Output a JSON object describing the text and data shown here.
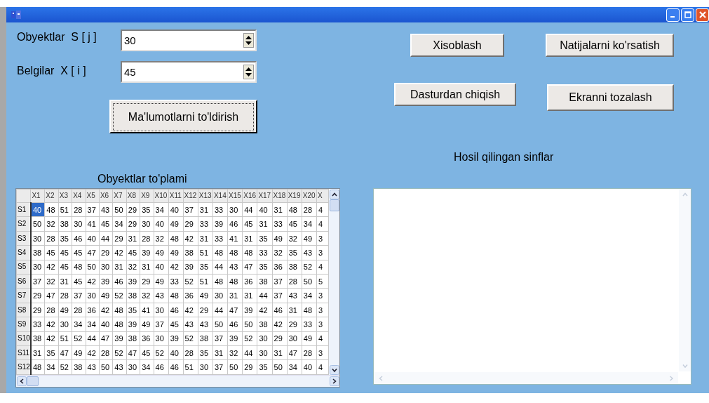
{
  "fields": [
    {
      "label": "Obyektlar  S [ j ]",
      "value": "30"
    },
    {
      "label": "Belgilar  X [ i ]",
      "value": "45"
    }
  ],
  "fill_button": {
    "label": "Ma'lumotlarni to'ldirish",
    "focused": true
  },
  "buttons": [
    {
      "label": "Xisoblash"
    },
    {
      "label": "Natijalarni ko'rsatish"
    },
    {
      "label": "Dasturdan chiqish"
    },
    {
      "label": "Ekranni tozalash"
    }
  ],
  "table": {
    "title": "Obyektlar to'plami",
    "columns": [
      "X1",
      "X2",
      "X3",
      "X4",
      "X5",
      "X6",
      "X7",
      "X8",
      "X9",
      "X10",
      "X11",
      "X12",
      "X13",
      "X14",
      "X15",
      "X16",
      "X17",
      "X18",
      "X19",
      "X20",
      "X"
    ],
    "rows": [
      {
        "header": "S1",
        "cells": [
          {
            "text": "40",
            "selected": true
          },
          {
            "text": "48",
            "selected": false
          },
          {
            "text": "51",
            "selected": false
          },
          {
            "text": "28",
            "selected": false
          },
          {
            "text": "37",
            "selected": false
          },
          {
            "text": "43",
            "selected": false
          },
          {
            "text": "50",
            "selected": false
          },
          {
            "text": "29",
            "selected": false
          },
          {
            "text": "35",
            "selected": false
          },
          {
            "text": "34",
            "selected": false
          },
          {
            "text": "40",
            "selected": false
          },
          {
            "text": "37",
            "selected": false
          },
          {
            "text": "31",
            "selected": false
          },
          {
            "text": "33",
            "selected": false
          },
          {
            "text": "30",
            "selected": false
          },
          {
            "text": "44",
            "selected": false
          },
          {
            "text": "40",
            "selected": false
          },
          {
            "text": "31",
            "selected": false
          },
          {
            "text": "48",
            "selected": false
          },
          {
            "text": "28",
            "selected": false
          },
          {
            "text": "4",
            "selected": false
          }
        ]
      },
      {
        "header": "S2",
        "cells": [
          {
            "text": "50",
            "selected": false
          },
          {
            "text": "32",
            "selected": false
          },
          {
            "text": "38",
            "selected": false
          },
          {
            "text": "30",
            "selected": false
          },
          {
            "text": "41",
            "selected": false
          },
          {
            "text": "45",
            "selected": false
          },
          {
            "text": "34",
            "selected": false
          },
          {
            "text": "29",
            "selected": false
          },
          {
            "text": "30",
            "selected": false
          },
          {
            "text": "40",
            "selected": false
          },
          {
            "text": "49",
            "selected": false
          },
          {
            "text": "29",
            "selected": false
          },
          {
            "text": "33",
            "selected": false
          },
          {
            "text": "39",
            "selected": false
          },
          {
            "text": "46",
            "selected": false
          },
          {
            "text": "45",
            "selected": false
          },
          {
            "text": "31",
            "selected": false
          },
          {
            "text": "33",
            "selected": false
          },
          {
            "text": "45",
            "selected": false
          },
          {
            "text": "34",
            "selected": false
          },
          {
            "text": "4",
            "selected": false
          }
        ]
      },
      {
        "header": "S3",
        "cells": [
          {
            "text": "30",
            "selected": false
          },
          {
            "text": "28",
            "selected": false
          },
          {
            "text": "35",
            "selected": false
          },
          {
            "text": "46",
            "selected": false
          },
          {
            "text": "40",
            "selected": false
          },
          {
            "text": "44",
            "selected": false
          },
          {
            "text": "29",
            "selected": false
          },
          {
            "text": "31",
            "selected": false
          },
          {
            "text": "28",
            "selected": false
          },
          {
            "text": "32",
            "selected": false
          },
          {
            "text": "48",
            "selected": false
          },
          {
            "text": "42",
            "selected": false
          },
          {
            "text": "31",
            "selected": false
          },
          {
            "text": "33",
            "selected": false
          },
          {
            "text": "41",
            "selected": false
          },
          {
            "text": "31",
            "selected": false
          },
          {
            "text": "35",
            "selected": false
          },
          {
            "text": "49",
            "selected": false
          },
          {
            "text": "32",
            "selected": false
          },
          {
            "text": "49",
            "selected": false
          },
          {
            "text": "3",
            "selected": false
          }
        ]
      },
      {
        "header": "S4",
        "cells": [
          {
            "text": "38",
            "selected": false
          },
          {
            "text": "45",
            "selected": false
          },
          {
            "text": "45",
            "selected": false
          },
          {
            "text": "45",
            "selected": false
          },
          {
            "text": "47",
            "selected": false
          },
          {
            "text": "29",
            "selected": false
          },
          {
            "text": "42",
            "selected": false
          },
          {
            "text": "45",
            "selected": false
          },
          {
            "text": "39",
            "selected": false
          },
          {
            "text": "49",
            "selected": false
          },
          {
            "text": "49",
            "selected": false
          },
          {
            "text": "38",
            "selected": false
          },
          {
            "text": "51",
            "selected": false
          },
          {
            "text": "48",
            "selected": false
          },
          {
            "text": "48",
            "selected": false
          },
          {
            "text": "48",
            "selected": false
          },
          {
            "text": "33",
            "selected": false
          },
          {
            "text": "32",
            "selected": false
          },
          {
            "text": "35",
            "selected": false
          },
          {
            "text": "43",
            "selected": false
          },
          {
            "text": "3",
            "selected": false
          }
        ]
      },
      {
        "header": "S5",
        "cells": [
          {
            "text": "30",
            "selected": false
          },
          {
            "text": "42",
            "selected": false
          },
          {
            "text": "45",
            "selected": false
          },
          {
            "text": "48",
            "selected": false
          },
          {
            "text": "50",
            "selected": false
          },
          {
            "text": "30",
            "selected": false
          },
          {
            "text": "31",
            "selected": false
          },
          {
            "text": "32",
            "selected": false
          },
          {
            "text": "31",
            "selected": false
          },
          {
            "text": "40",
            "selected": false
          },
          {
            "text": "42",
            "selected": false
          },
          {
            "text": "39",
            "selected": false
          },
          {
            "text": "35",
            "selected": false
          },
          {
            "text": "44",
            "selected": false
          },
          {
            "text": "43",
            "selected": false
          },
          {
            "text": "47",
            "selected": false
          },
          {
            "text": "35",
            "selected": false
          },
          {
            "text": "36",
            "selected": false
          },
          {
            "text": "38",
            "selected": false
          },
          {
            "text": "52",
            "selected": false
          },
          {
            "text": "4",
            "selected": false
          }
        ]
      },
      {
        "header": "S6",
        "cells": [
          {
            "text": "37",
            "selected": false
          },
          {
            "text": "32",
            "selected": false
          },
          {
            "text": "31",
            "selected": false
          },
          {
            "text": "45",
            "selected": false
          },
          {
            "text": "42",
            "selected": false
          },
          {
            "text": "39",
            "selected": false
          },
          {
            "text": "46",
            "selected": false
          },
          {
            "text": "39",
            "selected": false
          },
          {
            "text": "29",
            "selected": false
          },
          {
            "text": "49",
            "selected": false
          },
          {
            "text": "33",
            "selected": false
          },
          {
            "text": "52",
            "selected": false
          },
          {
            "text": "51",
            "selected": false
          },
          {
            "text": "48",
            "selected": false
          },
          {
            "text": "48",
            "selected": false
          },
          {
            "text": "36",
            "selected": false
          },
          {
            "text": "38",
            "selected": false
          },
          {
            "text": "37",
            "selected": false
          },
          {
            "text": "28",
            "selected": false
          },
          {
            "text": "50",
            "selected": false
          },
          {
            "text": "5",
            "selected": false
          }
        ]
      },
      {
        "header": "S7",
        "cells": [
          {
            "text": "29",
            "selected": false
          },
          {
            "text": "47",
            "selected": false
          },
          {
            "text": "28",
            "selected": false
          },
          {
            "text": "37",
            "selected": false
          },
          {
            "text": "30",
            "selected": false
          },
          {
            "text": "49",
            "selected": false
          },
          {
            "text": "52",
            "selected": false
          },
          {
            "text": "38",
            "selected": false
          },
          {
            "text": "32",
            "selected": false
          },
          {
            "text": "43",
            "selected": false
          },
          {
            "text": "48",
            "selected": false
          },
          {
            "text": "36",
            "selected": false
          },
          {
            "text": "49",
            "selected": false
          },
          {
            "text": "30",
            "selected": false
          },
          {
            "text": "31",
            "selected": false
          },
          {
            "text": "31",
            "selected": false
          },
          {
            "text": "44",
            "selected": false
          },
          {
            "text": "37",
            "selected": false
          },
          {
            "text": "43",
            "selected": false
          },
          {
            "text": "34",
            "selected": false
          },
          {
            "text": "3",
            "selected": false
          }
        ]
      },
      {
        "header": "S8",
        "cells": [
          {
            "text": "29",
            "selected": false
          },
          {
            "text": "28",
            "selected": false
          },
          {
            "text": "49",
            "selected": false
          },
          {
            "text": "28",
            "selected": false
          },
          {
            "text": "36",
            "selected": false
          },
          {
            "text": "42",
            "selected": false
          },
          {
            "text": "48",
            "selected": false
          },
          {
            "text": "35",
            "selected": false
          },
          {
            "text": "41",
            "selected": false
          },
          {
            "text": "30",
            "selected": false
          },
          {
            "text": "46",
            "selected": false
          },
          {
            "text": "42",
            "selected": false
          },
          {
            "text": "29",
            "selected": false
          },
          {
            "text": "44",
            "selected": false
          },
          {
            "text": "47",
            "selected": false
          },
          {
            "text": "39",
            "selected": false
          },
          {
            "text": "42",
            "selected": false
          },
          {
            "text": "46",
            "selected": false
          },
          {
            "text": "31",
            "selected": false
          },
          {
            "text": "48",
            "selected": false
          },
          {
            "text": "3",
            "selected": false
          }
        ]
      },
      {
        "header": "S9",
        "cells": [
          {
            "text": "33",
            "selected": false
          },
          {
            "text": "42",
            "selected": false
          },
          {
            "text": "30",
            "selected": false
          },
          {
            "text": "34",
            "selected": false
          },
          {
            "text": "34",
            "selected": false
          },
          {
            "text": "40",
            "selected": false
          },
          {
            "text": "48",
            "selected": false
          },
          {
            "text": "39",
            "selected": false
          },
          {
            "text": "49",
            "selected": false
          },
          {
            "text": "37",
            "selected": false
          },
          {
            "text": "45",
            "selected": false
          },
          {
            "text": "43",
            "selected": false
          },
          {
            "text": "43",
            "selected": false
          },
          {
            "text": "50",
            "selected": false
          },
          {
            "text": "46",
            "selected": false
          },
          {
            "text": "50",
            "selected": false
          },
          {
            "text": "38",
            "selected": false
          },
          {
            "text": "42",
            "selected": false
          },
          {
            "text": "29",
            "selected": false
          },
          {
            "text": "33",
            "selected": false
          },
          {
            "text": "3",
            "selected": false
          }
        ]
      },
      {
        "header": "S10",
        "cells": [
          {
            "text": "38",
            "selected": false
          },
          {
            "text": "42",
            "selected": false
          },
          {
            "text": "51",
            "selected": false
          },
          {
            "text": "52",
            "selected": false
          },
          {
            "text": "44",
            "selected": false
          },
          {
            "text": "47",
            "selected": false
          },
          {
            "text": "39",
            "selected": false
          },
          {
            "text": "38",
            "selected": false
          },
          {
            "text": "36",
            "selected": false
          },
          {
            "text": "30",
            "selected": false
          },
          {
            "text": "39",
            "selected": false
          },
          {
            "text": "52",
            "selected": false
          },
          {
            "text": "38",
            "selected": false
          },
          {
            "text": "37",
            "selected": false
          },
          {
            "text": "39",
            "selected": false
          },
          {
            "text": "52",
            "selected": false
          },
          {
            "text": "30",
            "selected": false
          },
          {
            "text": "29",
            "selected": false
          },
          {
            "text": "30",
            "selected": false
          },
          {
            "text": "49",
            "selected": false
          },
          {
            "text": "4",
            "selected": false
          }
        ]
      },
      {
        "header": "S11",
        "cells": [
          {
            "text": "31",
            "selected": false
          },
          {
            "text": "35",
            "selected": false
          },
          {
            "text": "47",
            "selected": false
          },
          {
            "text": "49",
            "selected": false
          },
          {
            "text": "42",
            "selected": false
          },
          {
            "text": "28",
            "selected": false
          },
          {
            "text": "52",
            "selected": false
          },
          {
            "text": "47",
            "selected": false
          },
          {
            "text": "45",
            "selected": false
          },
          {
            "text": "52",
            "selected": false
          },
          {
            "text": "40",
            "selected": false
          },
          {
            "text": "28",
            "selected": false
          },
          {
            "text": "35",
            "selected": false
          },
          {
            "text": "31",
            "selected": false
          },
          {
            "text": "32",
            "selected": false
          },
          {
            "text": "44",
            "selected": false
          },
          {
            "text": "30",
            "selected": false
          },
          {
            "text": "31",
            "selected": false
          },
          {
            "text": "47",
            "selected": false
          },
          {
            "text": "28",
            "selected": false
          },
          {
            "text": "3",
            "selected": false
          }
        ]
      },
      {
        "header": "S12",
        "cells": [
          {
            "text": "48",
            "selected": false
          },
          {
            "text": "34",
            "selected": false
          },
          {
            "text": "52",
            "selected": false
          },
          {
            "text": "38",
            "selected": false
          },
          {
            "text": "43",
            "selected": false
          },
          {
            "text": "50",
            "selected": false
          },
          {
            "text": "43",
            "selected": false
          },
          {
            "text": "30",
            "selected": false
          },
          {
            "text": "34",
            "selected": false
          },
          {
            "text": "46",
            "selected": false
          },
          {
            "text": "46",
            "selected": false
          },
          {
            "text": "51",
            "selected": false
          },
          {
            "text": "30",
            "selected": false
          },
          {
            "text": "37",
            "selected": false
          },
          {
            "text": "50",
            "selected": false
          },
          {
            "text": "29",
            "selected": false
          },
          {
            "text": "35",
            "selected": false
          },
          {
            "text": "50",
            "selected": false
          },
          {
            "text": "34",
            "selected": false
          },
          {
            "text": "40",
            "selected": false
          },
          {
            "text": "4",
            "selected": false
          }
        ]
      }
    ]
  },
  "results": {
    "title": "Hosil qilingan sinflar"
  }
}
